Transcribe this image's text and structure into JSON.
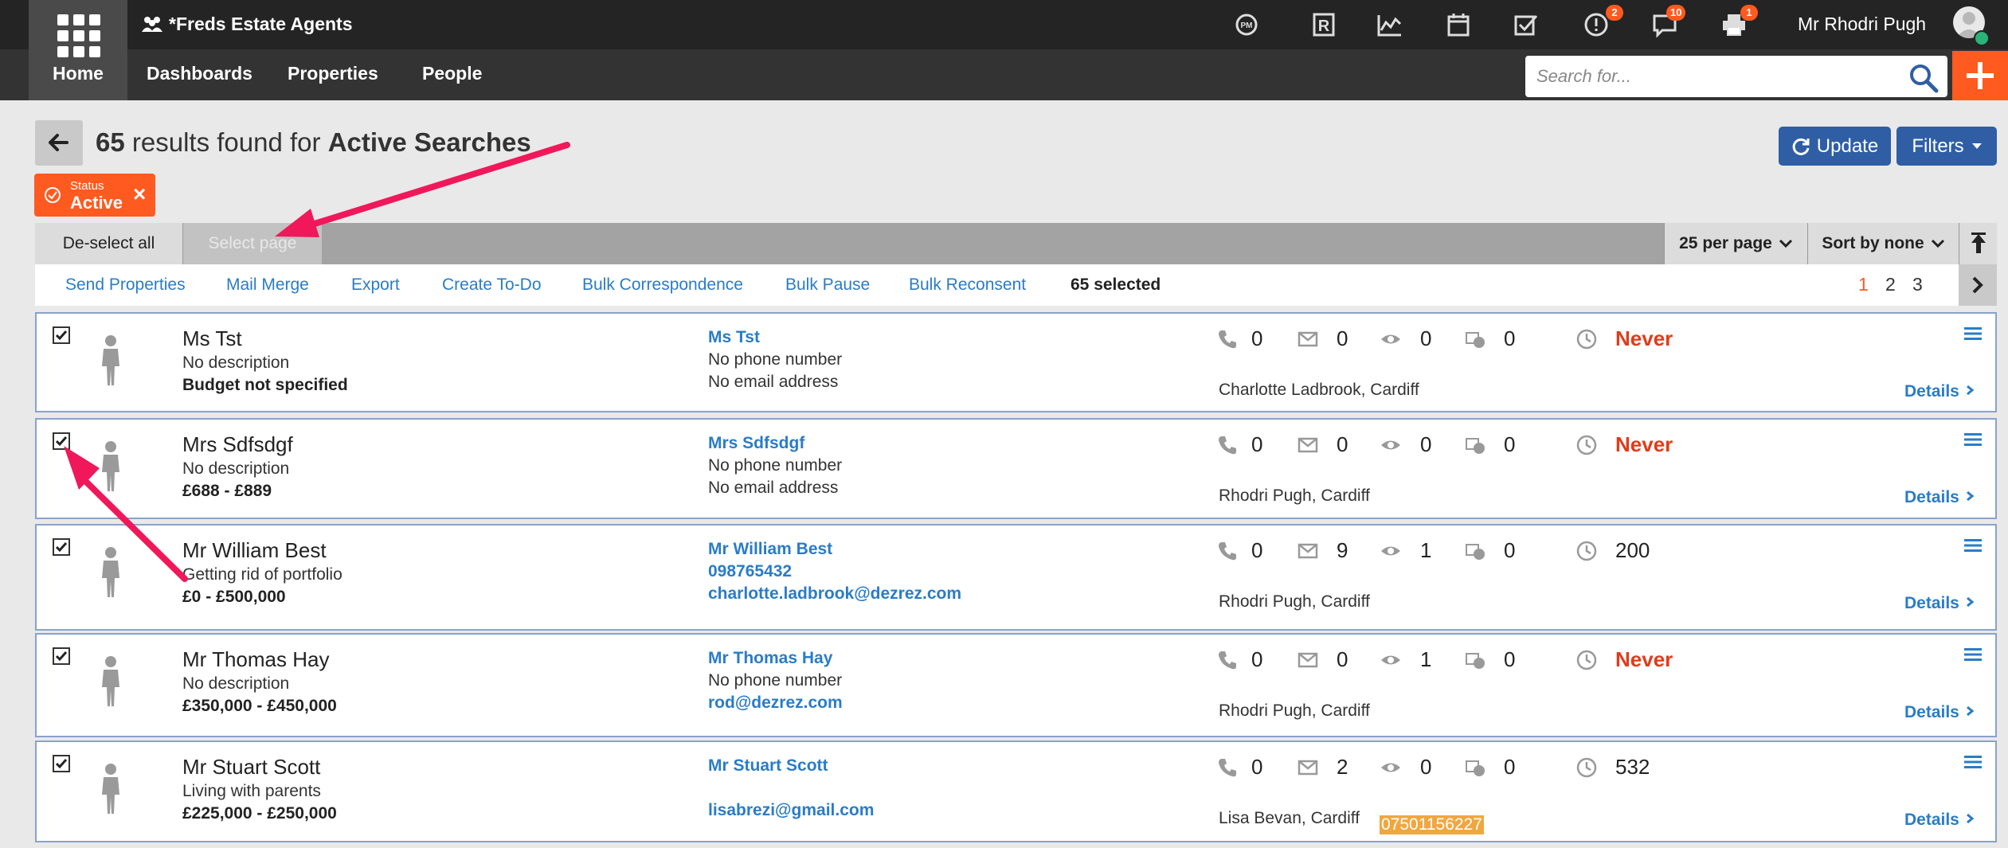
{
  "app": {
    "brand": "*Freds Estate Agents",
    "user": "Mr Rhodri Pugh",
    "badges": {
      "alerts": "2",
      "messages": "10",
      "print": "1"
    }
  },
  "nav": {
    "home": "Home",
    "dashboards": "Dashboards",
    "properties": "Properties",
    "people": "People"
  },
  "search": {
    "placeholder": "Search for..."
  },
  "header": {
    "count": "65",
    "results_text": "results found for",
    "subject": "Active Searches",
    "update_label": "Update",
    "filters_label": "Filters"
  },
  "filter_chip": {
    "label": "Status",
    "value": "Active",
    "remove": "×"
  },
  "selection": {
    "deselect_all": "De-select all",
    "select_page": "Select page",
    "per_page": "25 per page",
    "sort": "Sort by none"
  },
  "actions": {
    "send_properties": "Send Properties",
    "mail_merge": "Mail Merge",
    "export": "Export",
    "create_todo": "Create To-Do",
    "bulk_correspondence": "Bulk Correspondence",
    "bulk_pause": "Bulk Pause",
    "bulk_reconsent": "Bulk Reconsent",
    "selected": "65 selected"
  },
  "pagination": {
    "pages": [
      "1",
      "2",
      "3"
    ],
    "current": "1"
  },
  "records": [
    {
      "name": "Ms Tst",
      "description": "No description",
      "budget": "Budget not specified",
      "contact_name": "Ms Tst",
      "phone": "No phone number",
      "email": "No email address",
      "calls": "0",
      "emails": "0",
      "viewings": "0",
      "offers": "0",
      "last": "Never",
      "negotiator": "Charlotte Ladbrook, Cardiff",
      "details": "Details",
      "checked": true
    },
    {
      "name": "Mrs Sdfsdgf",
      "description": "No description",
      "budget": "£688 - £889",
      "contact_name": "Mrs Sdfsdgf",
      "phone": "No phone number",
      "email": "No email address",
      "calls": "0",
      "emails": "0",
      "viewings": "0",
      "offers": "0",
      "last": "Never",
      "negotiator": "Rhodri Pugh, Cardiff",
      "details": "Details",
      "checked": true
    },
    {
      "name": "Mr William Best",
      "description": "Getting rid of portfolio",
      "budget": "£0 - £500,000",
      "contact_name": "Mr William Best",
      "phone": "098765432",
      "email": "charlotte.ladbrook@dezrez.com",
      "calls": "0",
      "emails": "9",
      "viewings": "1",
      "offers": "0",
      "last": "200",
      "negotiator": "Rhodri Pugh, Cardiff",
      "details": "Details",
      "checked": true
    },
    {
      "name": "Mr Thomas Hay",
      "description": "No description",
      "budget": "£350,000 - £450,000",
      "contact_name": "Mr Thomas Hay",
      "phone": "No phone number",
      "email": "rod@dezrez.com",
      "calls": "0",
      "emails": "0",
      "viewings": "1",
      "offers": "0",
      "last": "Never",
      "negotiator": "Rhodri Pugh, Cardiff",
      "details": "Details",
      "checked": true
    },
    {
      "name": "Mr Stuart Scott",
      "description": "Living with parents",
      "budget": "£225,000 - £250,000",
      "contact_name": "Mr Stuart Scott",
      "phone": "07501156227",
      "email": "lisabrezi@gmail.com",
      "calls": "0",
      "emails": "2",
      "viewings": "0",
      "offers": "0",
      "last": "532",
      "negotiator": "Lisa Bevan, Cardiff",
      "details": "Details",
      "checked": true
    }
  ],
  "colors": {
    "accent": "#ff5a1f",
    "primary": "#2f5ea5",
    "link": "#2a7cc7",
    "never": "#e03c1a",
    "annotation": "#f0185a"
  }
}
